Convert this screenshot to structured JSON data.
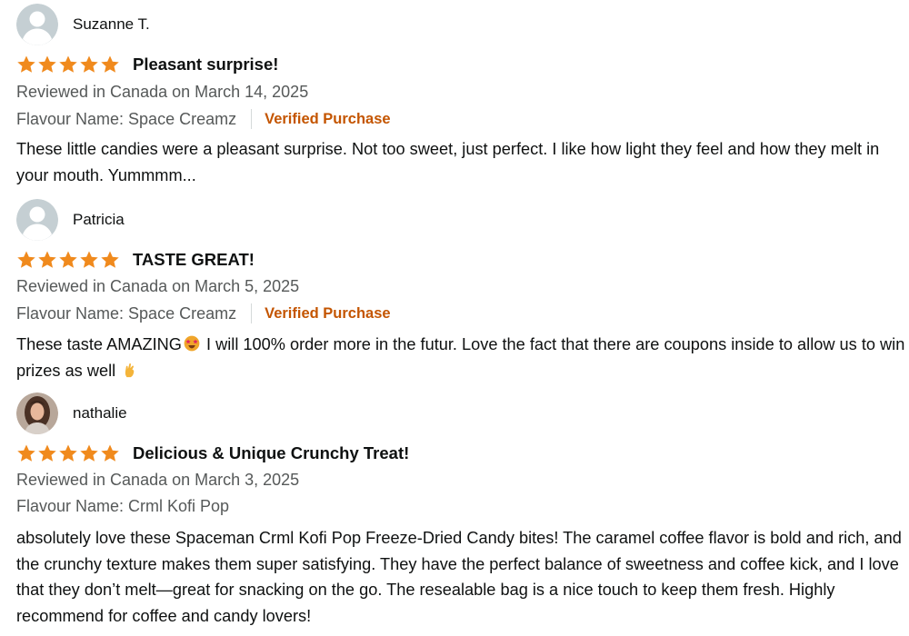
{
  "colors": {
    "star": "#f08a1d",
    "verified": "#c45500",
    "meta": "#565959",
    "text": "#0f1111",
    "avatar_default": "#c5cfd3"
  },
  "reviews": [
    {
      "name": "Suzanne T.",
      "avatar": "default-avatar",
      "rating": 5,
      "title": "Pleasant surprise!",
      "date_line": "Reviewed in Canada on March 14, 2025",
      "variant": "Flavour Name: Space Creamz",
      "verified": "Verified Purchase",
      "body": "These little candies were a pleasant surprise. Not too sweet, just perfect. I like how light they feel and how they melt in your mouth. Yummmm..."
    },
    {
      "name": "Patricia",
      "avatar": "default-avatar",
      "rating": 5,
      "title": "TASTE GREAT!",
      "date_line": "Reviewed in Canada on March 5, 2025",
      "variant": "Flavour Name: Space Creamz",
      "verified": "Verified Purchase",
      "body_part1": "These taste AMAZING",
      "emoji1": "star-struck-emoji",
      "body_part2": " I will 100% order more in the futur. Love the fact that there are coupons inside to allow us to win prizes as well ",
      "emoji2": "fingers-crossed-emoji"
    },
    {
      "name": "nathalie",
      "avatar": "photo-avatar",
      "rating": 5,
      "title": "Delicious & Unique Crunchy Treat!",
      "date_line": "Reviewed in Canada on March 3, 2025",
      "variant": "Flavour Name: Crml Kofi Pop",
      "body": "absolutely love these Spaceman Crml Kofi Pop Freeze-Dried Candy bites! The caramel coffee flavor is bold and rich, and the crunchy texture makes them super satisfying. They have the perfect balance of sweetness and coffee kick, and I love that they don’t melt—great for snacking on the go. The resealable bag is a nice touch to keep them fresh. Highly recommend for coffee and candy lovers!"
    }
  ]
}
